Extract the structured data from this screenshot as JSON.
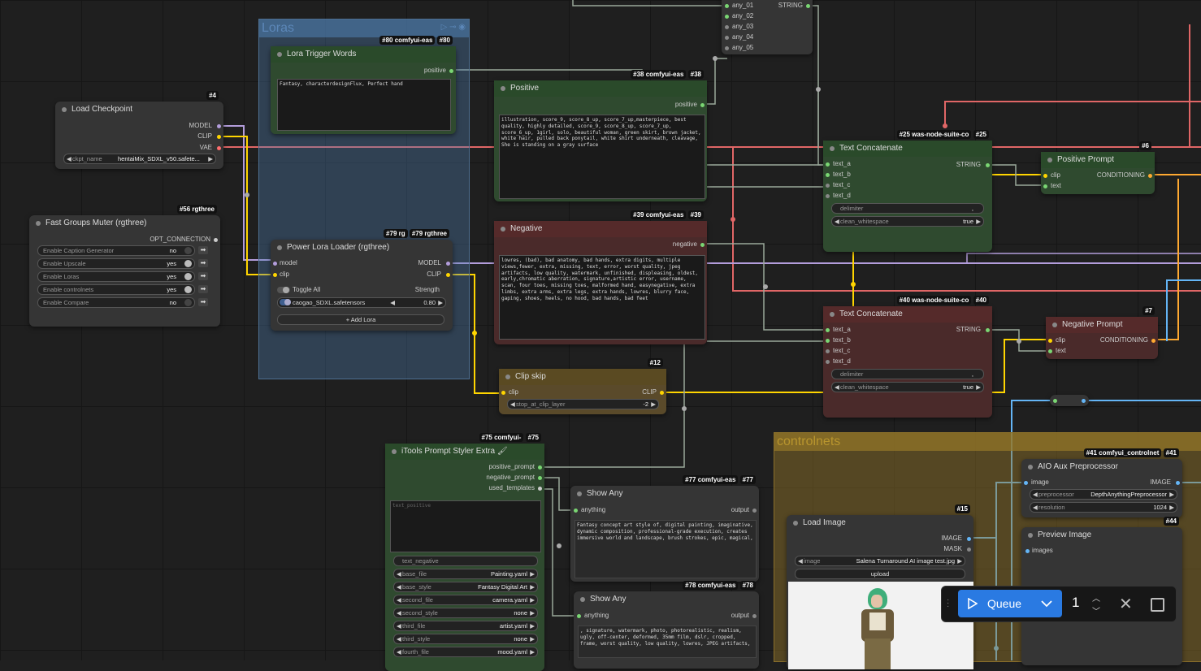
{
  "groups": {
    "loras": {
      "title": "Loras"
    },
    "controlnets": {
      "title": "controlnets"
    }
  },
  "nodes": {
    "load_checkpoint": {
      "id": "#4",
      "title": "Load Checkpoint",
      "outputs": [
        "MODEL",
        "CLIP",
        "VAE"
      ],
      "widget": {
        "label": "ckpt_name",
        "value": "hentaiMix_SDXL_v50.safete..."
      }
    },
    "fast_groups_muter": {
      "id": "#56 rgthree",
      "title": "Fast Groups Muter (rgthree)",
      "output": "OPT_CONNECTION",
      "rows": [
        {
          "label": "Enable Caption Generator",
          "value": "no"
        },
        {
          "label": "Enable Upscale",
          "value": "yes"
        },
        {
          "label": "Enable Loras",
          "value": "yes"
        },
        {
          "label": "Enable controlnets",
          "value": "yes"
        },
        {
          "label": "Enable Compare",
          "value": "no"
        }
      ]
    },
    "lora_trigger": {
      "id": "#80",
      "pack": "#80 comfyui-eas",
      "title": "Lora Trigger Words",
      "output": "positive",
      "text": "Fantasy, characterdesignFlux, Perfect hand"
    },
    "power_lora": {
      "id": "#79 rgthree",
      "pack": "#79 rg",
      "title": "Power Lora Loader (rgthree)",
      "inputs": [
        "model",
        "clip"
      ],
      "outputs": [
        "MODEL",
        "CLIP"
      ],
      "toggle_all": "Toggle All",
      "strength_label": "Strength",
      "lora_name": "caogao_SDXL.safetensors",
      "strength": "0.80",
      "add_label": "+ Add Lora"
    },
    "positive": {
      "id": "#38",
      "pack": "#38 comfyui-eas",
      "title": "Positive",
      "output": "positive",
      "text": "illustration, score_9, score_8_up, score_7_up,masterpiece, best quality, highly detailed, score_9, score_8_up, score_7_up, score_6_up, 1girl, solo, beautiful woman, green skirt, brown jacket, white hair, pulled back ponytail, white shirt underneath, cleavage, She is standing on a gray surface"
    },
    "negative": {
      "id": "#39",
      "pack": "#39 comfyui-eas",
      "title": "Negative",
      "output": "negative",
      "text": "lowres, (bad), bad anatomy, bad hands, extra digits, multiple views,fewer, extra, missing, text, error, worst quality, jpeg artifacts, low quality, watermark, unfinished, displeasing, oldest, early,chromatic aberration, signature,artistic error, username, scan, four toes, missing toes, malformed hand, easynegative, extra limbs, extra arms, extra legs, extra hands, lowres, blurry face, gaping, shoes, heels, no hood, bad hands, bad feet"
    },
    "any_switch": {
      "inputs": [
        "any_01",
        "any_02",
        "any_03",
        "any_04",
        "any_05"
      ],
      "output": "STRING"
    },
    "text_concat_pos": {
      "id": "#25",
      "pack": "#25 was-node-suite-co",
      "title": "Text Concatenate",
      "inputs": [
        "text_a",
        "text_b",
        "text_c",
        "text_d"
      ],
      "output": "STRING",
      "delimiter_label": "delimiter",
      "delimiter_value": ",",
      "clean_label": "clean_whitespace",
      "clean_value": "true"
    },
    "text_concat_neg": {
      "id": "#40",
      "pack": "#40 was-node-suite-co",
      "title": "Text Concatenate",
      "inputs": [
        "text_a",
        "text_b",
        "text_c",
        "text_d"
      ],
      "output": "STRING",
      "delimiter_label": "delimiter",
      "delimiter_value": ",",
      "clean_label": "clean_whitespace",
      "clean_value": "true"
    },
    "positive_prompt": {
      "id": "#6",
      "title": "Positive Prompt",
      "inputs": [
        "clip",
        "text"
      ],
      "output": "CONDITIONING"
    },
    "negative_prompt": {
      "id": "#7",
      "title": "Negative Prompt",
      "inputs": [
        "clip",
        "text"
      ],
      "output": "CONDITIONING"
    },
    "clip_skip": {
      "id": "#12",
      "title": "Clip skip",
      "input": "clip",
      "output": "CLIP",
      "widget_label": "stop_at_clip_layer",
      "widget_value": "-2"
    },
    "itools": {
      "id": "#75",
      "pack": "#75 comfyui-",
      "title": "iTools Prompt Styler Extra 🖌",
      "outputs": [
        "positive_prompt",
        "negative_prompt",
        "used_templates"
      ],
      "placeholder_pos": "text_positive",
      "placeholder_neg": "text_negative",
      "widgets": [
        {
          "label": "base_file",
          "value": "Painting.yaml"
        },
        {
          "label": "base_style",
          "value": "Fantasy Digital Art"
        },
        {
          "label": "second_file",
          "value": "camera.yaml"
        },
        {
          "label": "second_style",
          "value": "none"
        },
        {
          "label": "third_file",
          "value": "artist.yaml"
        },
        {
          "label": "third_style",
          "value": "none"
        },
        {
          "label": "fourth_file",
          "value": "mood.yaml"
        }
      ]
    },
    "show_any_77": {
      "id": "#77",
      "pack": "#77 comfyui-eas",
      "title": "Show Any",
      "input": "anything",
      "output": "output",
      "text": "Fantasy concept art style of, digital painting, imaginative, dynamic composition, professional-grade execution, creates immersive world and landscape, brush strokes, epic, magical,"
    },
    "show_any_78": {
      "id": "#78",
      "pack": "#78 comfyui-eas",
      "title": "Show Any",
      "input": "anything",
      "output": "output",
      "text": ", signature, watermark, photo, photorealistic, realism, ugly, off-center, deformed, 35mm film, dslr, cropped, frame, worst quality, low quality, lowres, JPEG artifacts,"
    },
    "load_image": {
      "id": "#15",
      "title": "Load Image",
      "outputs": [
        "IMAGE",
        "MASK"
      ],
      "widget_label": "image",
      "widget_value": "Salena Turnaround AI image test.jpg",
      "upload_label": "upload"
    },
    "aio_aux": {
      "id": "#41",
      "pack": "#41 comfyui_controlnet",
      "title": "AIO Aux Preprocessor",
      "input": "image",
      "output": "IMAGE",
      "widgets": [
        {
          "label": "preprocessor",
          "value": "DepthAnythingPreprocessor"
        },
        {
          "label": "resolution",
          "value": "1024"
        }
      ]
    },
    "preview_image": {
      "id": "#44",
      "title": "Preview Image",
      "input": "images"
    }
  },
  "queue": {
    "label": "Queue",
    "count": "1"
  },
  "colors": {
    "model": "#b39ddb",
    "clip": "#ffd500",
    "vae": "#ff6e6e",
    "string": "#7ad673",
    "conditioning": "#ffa931",
    "image": "#64b5f6",
    "accent": "#2a7ae2"
  }
}
